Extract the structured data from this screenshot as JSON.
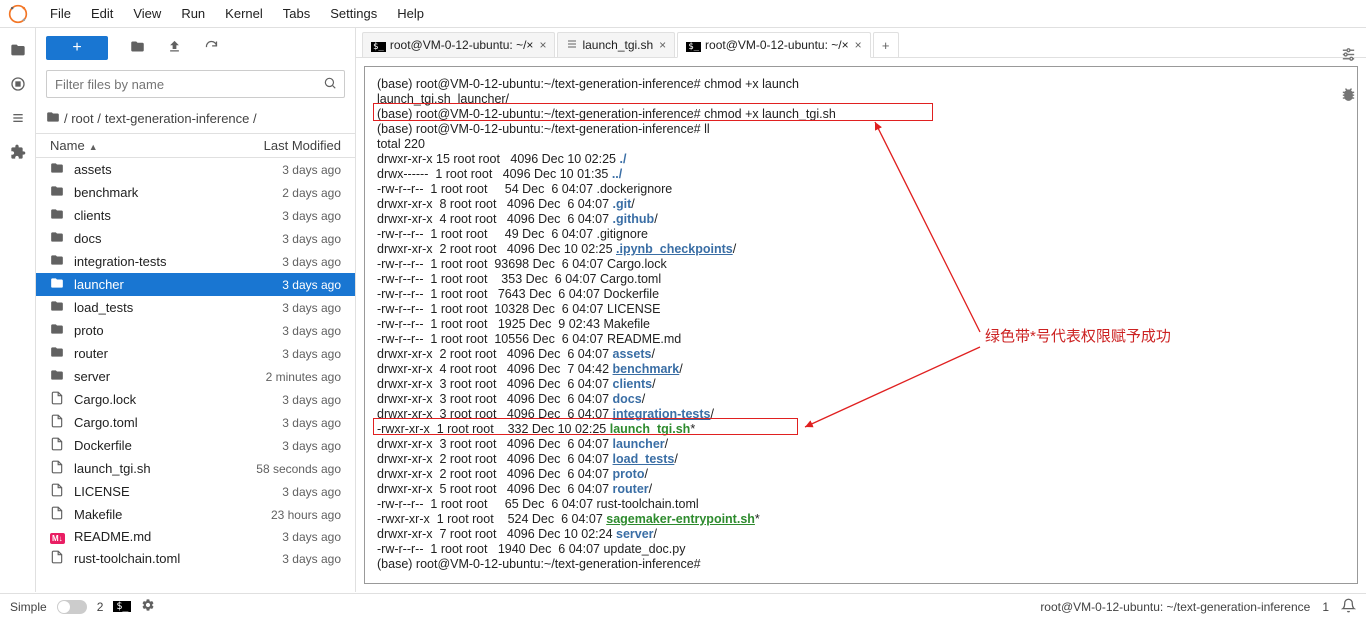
{
  "menu": [
    "File",
    "Edit",
    "View",
    "Run",
    "Kernel",
    "Tabs",
    "Settings",
    "Help"
  ],
  "filter_placeholder": "Filter files by name",
  "breadcrumb": {
    "root": "/ root /",
    "path": "text-generation-inference /"
  },
  "columns": {
    "name": "Name",
    "modified": "Last Modified"
  },
  "files": [
    {
      "icon": "folder",
      "name": "assets",
      "mod": "3 days ago"
    },
    {
      "icon": "folder",
      "name": "benchmark",
      "mod": "2 days ago"
    },
    {
      "icon": "folder",
      "name": "clients",
      "mod": "3 days ago"
    },
    {
      "icon": "folder",
      "name": "docs",
      "mod": "3 days ago"
    },
    {
      "icon": "folder",
      "name": "integration-tests",
      "mod": "3 days ago"
    },
    {
      "icon": "folder",
      "name": "launcher",
      "mod": "3 days ago",
      "selected": true
    },
    {
      "icon": "folder",
      "name": "load_tests",
      "mod": "3 days ago"
    },
    {
      "icon": "folder",
      "name": "proto",
      "mod": "3 days ago"
    },
    {
      "icon": "folder",
      "name": "router",
      "mod": "3 days ago"
    },
    {
      "icon": "folder",
      "name": "server",
      "mod": "2 minutes ago"
    },
    {
      "icon": "file",
      "name": "Cargo.lock",
      "mod": "3 days ago"
    },
    {
      "icon": "file",
      "name": "Cargo.toml",
      "mod": "3 days ago"
    },
    {
      "icon": "file",
      "name": "Dockerfile",
      "mod": "3 days ago"
    },
    {
      "icon": "file",
      "name": "launch_tgi.sh",
      "mod": "58 seconds ago"
    },
    {
      "icon": "file",
      "name": "LICENSE",
      "mod": "3 days ago"
    },
    {
      "icon": "file",
      "name": "Makefile",
      "mod": "23 hours ago"
    },
    {
      "icon": "md",
      "name": "README.md",
      "mod": "3 days ago"
    },
    {
      "icon": "file",
      "name": "rust-toolchain.toml",
      "mod": "3 days ago"
    }
  ],
  "tabs": [
    {
      "icon": "term",
      "label": "root@VM-0-12-ubuntu: ~/×",
      "active": false
    },
    {
      "icon": "sh",
      "label": "launch_tgi.sh",
      "active": false
    },
    {
      "icon": "term",
      "label": "root@VM-0-12-ubuntu: ~/×",
      "active": true
    }
  ],
  "terminal": {
    "lines": [
      [
        {
          "t": "(base) root@VM-0-12-ubuntu:~/text-generation-inference# chmod +x launch"
        }
      ],
      [
        {
          "t": "launch_tgi.sh  launcher/"
        }
      ],
      [
        {
          "t": "(base) root@VM-0-12-ubuntu:~/text-generation-inference# chmod +x launch_tgi.sh"
        }
      ],
      [
        {
          "t": "(base) root@VM-0-12-ubuntu:~/text-generation-inference# ll"
        }
      ],
      [
        {
          "t": "total 220"
        }
      ],
      [
        {
          "t": "drwxr-xr-x 15 root root   4096 Dec 10 02:25 "
        },
        {
          "t": "./",
          "c": "blueb"
        }
      ],
      [
        {
          "t": "drwx------  1 root root   4096 Dec 10 01:35 "
        },
        {
          "t": "../",
          "c": "blueb"
        }
      ],
      [
        {
          "t": "-rw-r--r--  1 root root     54 Dec  6 04:07 .dockerignore"
        }
      ],
      [
        {
          "t": "drwxr-xr-x  8 root root   4096 Dec  6 04:07 "
        },
        {
          "t": ".git",
          "c": "blueb"
        },
        {
          "t": "/"
        }
      ],
      [
        {
          "t": "drwxr-xr-x  4 root root   4096 Dec  6 04:07 "
        },
        {
          "t": ".github",
          "c": "blueb"
        },
        {
          "t": "/"
        }
      ],
      [
        {
          "t": "-rw-r--r--  1 root root     49 Dec  6 04:07 .gitignore"
        }
      ],
      [
        {
          "t": "drwxr-xr-x  2 root root   4096 Dec 10 02:25 "
        },
        {
          "t": ".ipynb_checkpoints",
          "c": "blueb underline"
        },
        {
          "t": "/"
        }
      ],
      [
        {
          "t": "-rw-r--r--  1 root root  93698 Dec  6 04:07 Cargo.lock"
        }
      ],
      [
        {
          "t": "-rw-r--r--  1 root root    353 Dec  6 04:07 Cargo.toml"
        }
      ],
      [
        {
          "t": "-rw-r--r--  1 root root   7643 Dec  6 04:07 Dockerfile"
        }
      ],
      [
        {
          "t": "-rw-r--r--  1 root root  10328 Dec  6 04:07 LICENSE"
        }
      ],
      [
        {
          "t": "-rw-r--r--  1 root root   1925 Dec  9 02:43 Makefile"
        }
      ],
      [
        {
          "t": "-rw-r--r--  1 root root  10556 Dec  6 04:07 README.md"
        }
      ],
      [
        {
          "t": "drwxr-xr-x  2 root root   4096 Dec  6 04:07 "
        },
        {
          "t": "assets",
          "c": "blueb"
        },
        {
          "t": "/"
        }
      ],
      [
        {
          "t": "drwxr-xr-x  4 root root   4096 Dec  7 04:42 "
        },
        {
          "t": "benchmark",
          "c": "blueb underline"
        },
        {
          "t": "/"
        }
      ],
      [
        {
          "t": "drwxr-xr-x  3 root root   4096 Dec  6 04:07 "
        },
        {
          "t": "clients",
          "c": "blueb"
        },
        {
          "t": "/"
        }
      ],
      [
        {
          "t": "drwxr-xr-x  3 root root   4096 Dec  6 04:07 "
        },
        {
          "t": "docs",
          "c": "blueb"
        },
        {
          "t": "/"
        }
      ],
      [
        {
          "t": "drwxr-xr-x  3 root root   4096 Dec  6 04:07 "
        },
        {
          "t": "integration-tests",
          "c": "blueb underline"
        },
        {
          "t": "/"
        }
      ],
      [
        {
          "t": "-rwxr-xr-x  1 root root    332 Dec 10 02:25 "
        },
        {
          "t": "launch_tgi.sh",
          "c": "green underline"
        },
        {
          "t": "*"
        }
      ],
      [
        {
          "t": "drwxr-xr-x  3 root root   4096 Dec  6 04:07 "
        },
        {
          "t": "launcher",
          "c": "blueb"
        },
        {
          "t": "/"
        }
      ],
      [
        {
          "t": "drwxr-xr-x  2 root root   4096 Dec  6 04:07 "
        },
        {
          "t": "load_tests",
          "c": "blueb underline"
        },
        {
          "t": "/"
        }
      ],
      [
        {
          "t": "drwxr-xr-x  2 root root   4096 Dec  6 04:07 "
        },
        {
          "t": "proto",
          "c": "blueb"
        },
        {
          "t": "/"
        }
      ],
      [
        {
          "t": "drwxr-xr-x  5 root root   4096 Dec  6 04:07 "
        },
        {
          "t": "router",
          "c": "blueb"
        },
        {
          "t": "/"
        }
      ],
      [
        {
          "t": "-rw-r--r--  1 root root     65 Dec  6 04:07 rust-toolchain.toml"
        }
      ],
      [
        {
          "t": "-rwxr-xr-x  1 root root    524 Dec  6 04:07 "
        },
        {
          "t": "sagemaker-entrypoint.sh",
          "c": "green underline"
        },
        {
          "t": "*"
        }
      ],
      [
        {
          "t": "drwxr-xr-x  7 root root   4096 Dec 10 02:24 "
        },
        {
          "t": "server",
          "c": "blueb"
        },
        {
          "t": "/"
        }
      ],
      [
        {
          "t": "-rw-r--r--  1 root root   1940 Dec  6 04:07 update_doc.py"
        }
      ],
      [
        {
          "t": "(base) root@VM-0-12-ubuntu:~/text-generation-inference# "
        }
      ]
    ]
  },
  "annotation": "绿色带*号代表权限赋予成功",
  "statusbar": {
    "mode": "Simple",
    "count": "2",
    "path": "root@VM-0-12-ubuntu: ~/text-generation-inference",
    "num": "1"
  }
}
